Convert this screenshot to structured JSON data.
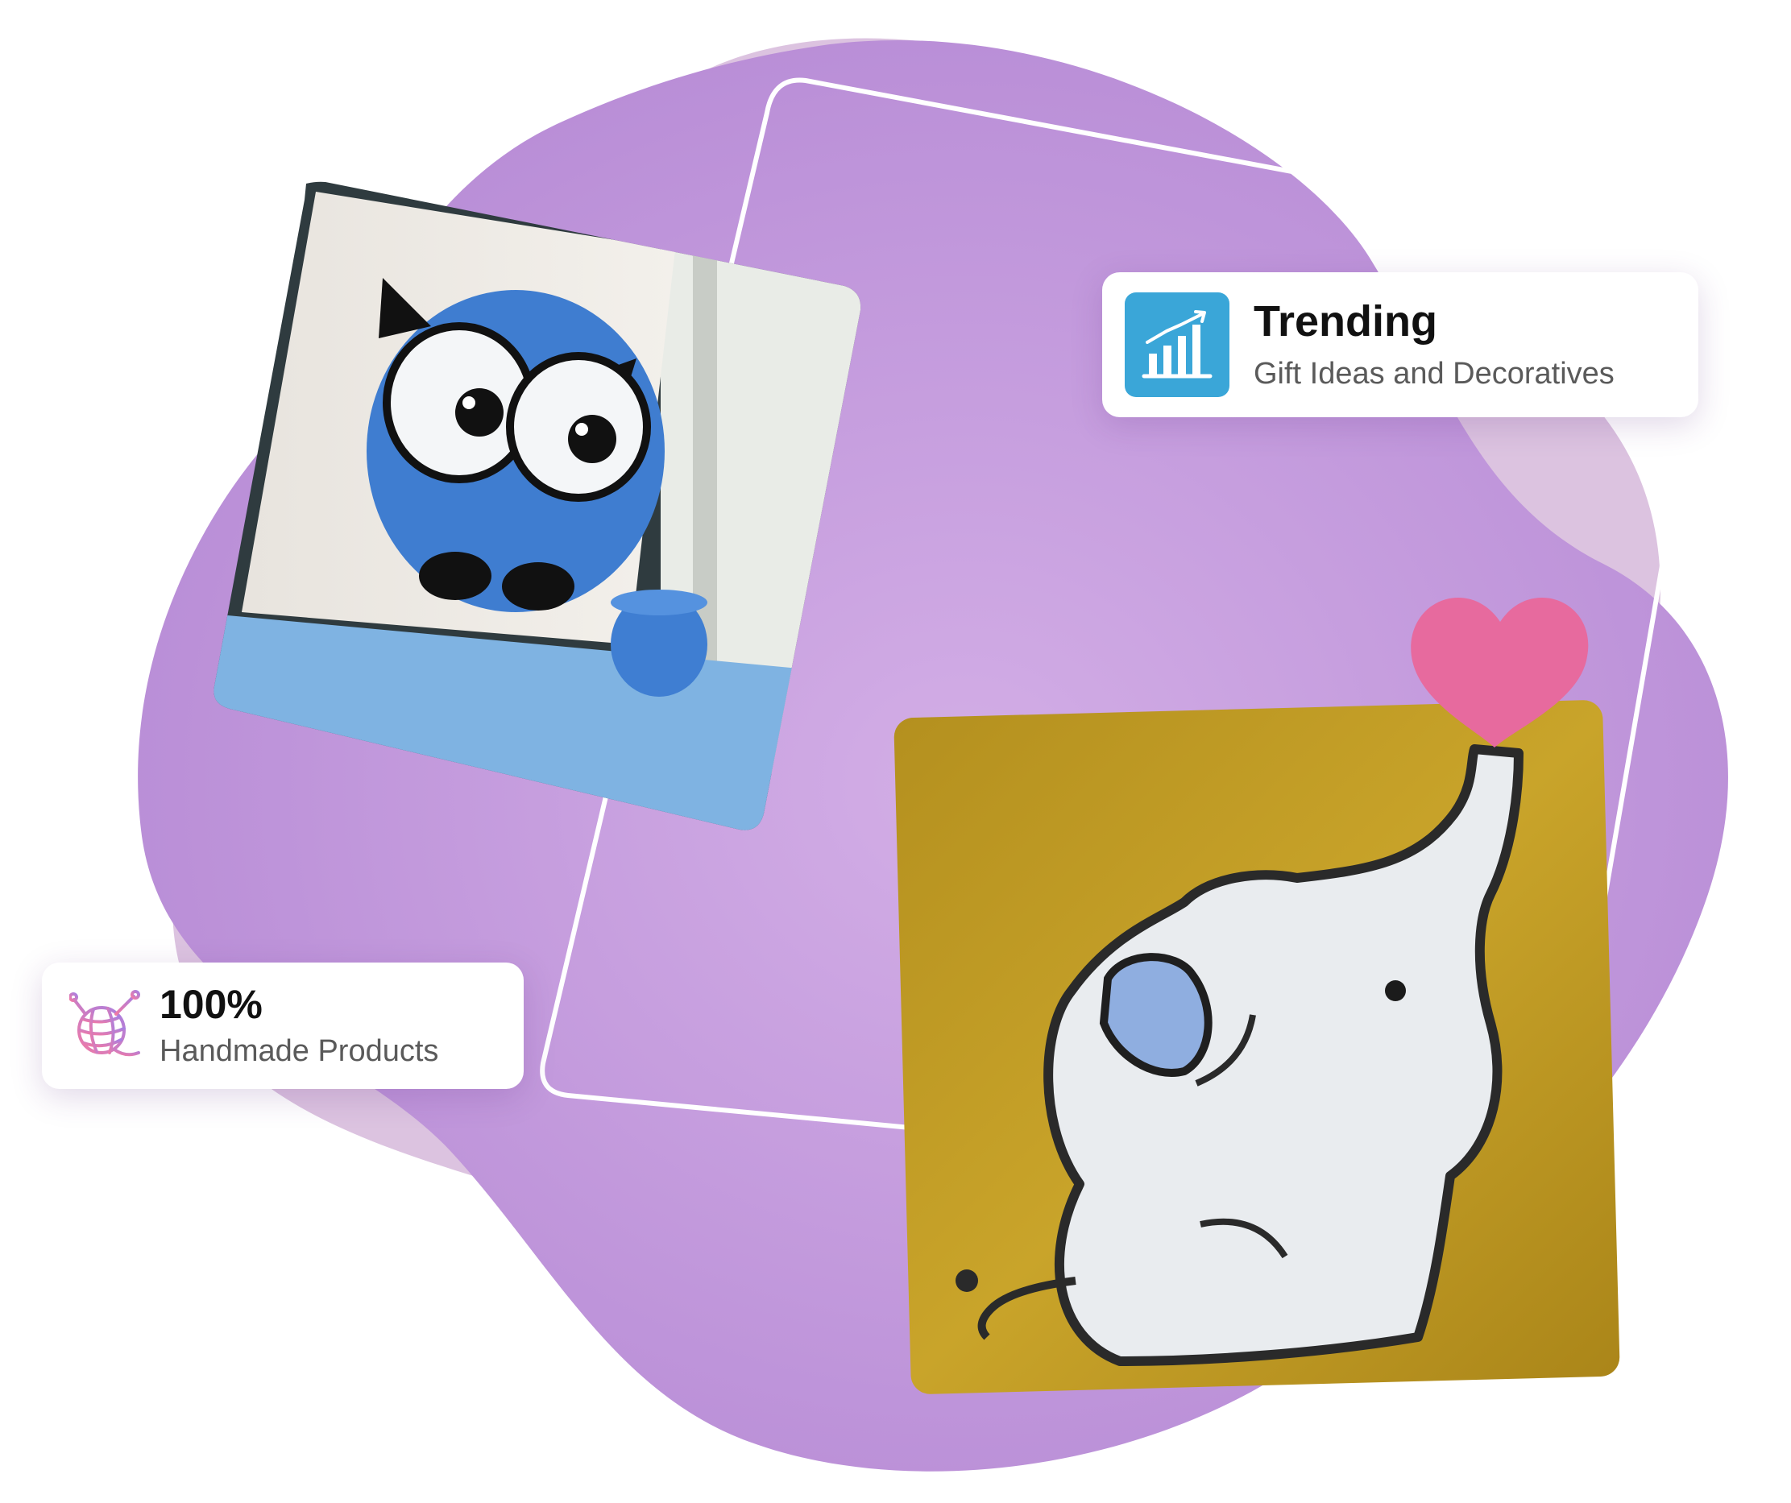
{
  "cards": {
    "trending": {
      "title": "Trending",
      "subtitle": "Gift Ideas and Decoratives",
      "icon": "bar-chart-growth-icon"
    },
    "handmade": {
      "title": "100%",
      "subtitle": "Handmade Products",
      "icon": "yarn-ball-icon"
    }
  },
  "images": {
    "owl": "owl-string-art-photo",
    "elephant": "elephant-string-art-photo",
    "heart": "heart-icon"
  },
  "colors": {
    "blob_back": "#dcc3e0",
    "blob_front": "#b58bd6",
    "blob_center": "#cda6e4",
    "accent_blue": "#3aa6d8",
    "heart_pink": "#e76a9e",
    "frame_stroke": "#ffffff"
  }
}
